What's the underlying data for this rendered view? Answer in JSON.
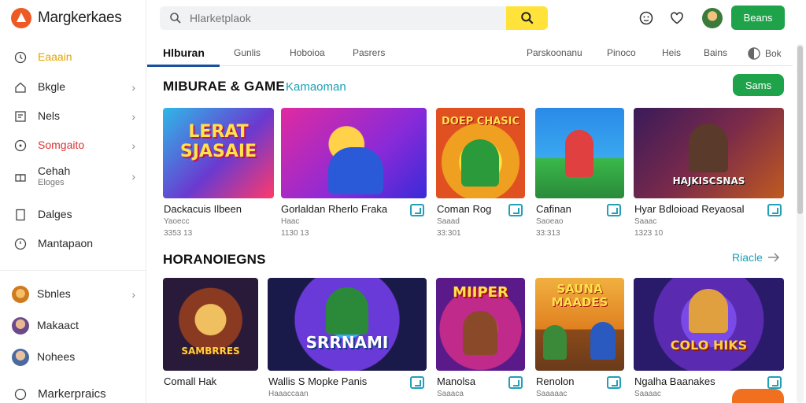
{
  "app": {
    "logo_text": "Margkerkaes",
    "brand_color": "#ee5a24"
  },
  "sidebar": {
    "items": [
      {
        "label": "Eaaain",
        "icon": "clock-icon",
        "state": "active"
      },
      {
        "label": "Bkgle",
        "icon": "home-icon",
        "chevron": true
      },
      {
        "label": "Nels",
        "icon": "list-icon",
        "chevron": true
      },
      {
        "label": "Somgaito",
        "icon": "ring-icon",
        "chevron": true,
        "state": "warn"
      },
      {
        "label": "Cehah",
        "sub": "Eloges",
        "icon": "gift-icon",
        "chevron": true
      },
      {
        "label": "Dalges",
        "icon": "page-icon"
      },
      {
        "label": "Mantapaon",
        "icon": "clock-icon"
      }
    ],
    "people": [
      {
        "label": "Sbnles",
        "chevron": true
      },
      {
        "label": "Makaact"
      },
      {
        "label": "Nohees"
      }
    ],
    "bottom_label": "Markerpraics"
  },
  "search": {
    "placeholder": "Hlarketplaok"
  },
  "topbar": {
    "button_label": "Beans"
  },
  "tabs": [
    "Hlburan",
    "Gunlis",
    "Hoboioa",
    "Pasrers",
    "Parskoonanu",
    "Pinoco",
    "Heis",
    "Bains",
    "Bok"
  ],
  "sections": {
    "first": {
      "title": "MIBURAE & GAME",
      "subtitle": "Kamaoman",
      "button_label": "Sams"
    },
    "second": {
      "title": "HORANOIEGNS",
      "link_label": "Riacle"
    }
  },
  "cards_row1": [
    {
      "title": "Dackacuis Ilbeen",
      "meta1": "Yaoecc",
      "meta2": "3353 13",
      "art": "LERAT SJASAIE"
    },
    {
      "title": "Gorlaldan Rherlo Fraka",
      "meta1": "Haac",
      "meta2": "1130 13",
      "art": ""
    },
    {
      "title": "Coman Rog",
      "meta1": "Saaad",
      "meta2": "33:301",
      "art": "DOEP CHASIC"
    },
    {
      "title": "Cafinan",
      "meta1": "Saoeao",
      "meta2": "33:313",
      "art": ""
    },
    {
      "title": "Hyar Bdloioad Reyaosal",
      "meta1": "Saaac",
      "meta2": "1323 10",
      "art": "HAJKISCSNAS"
    }
  ],
  "cards_row2": [
    {
      "title": "Comall Hak",
      "meta1": "",
      "art": "SAMBRRES"
    },
    {
      "title": "Wallis S Mopke Panis",
      "meta1": "Haaaccaan",
      "art": "SRRNAMI"
    },
    {
      "title": "Manolsa",
      "meta1": "Saaaca",
      "art": "MIIPER"
    },
    {
      "title": "Renolon",
      "meta1": "Saaaaac",
      "art": "SAUNA MAADES"
    },
    {
      "title": "Ngalha Baanakes",
      "meta1": "Saaaac",
      "art": "COLO HIKS"
    }
  ]
}
